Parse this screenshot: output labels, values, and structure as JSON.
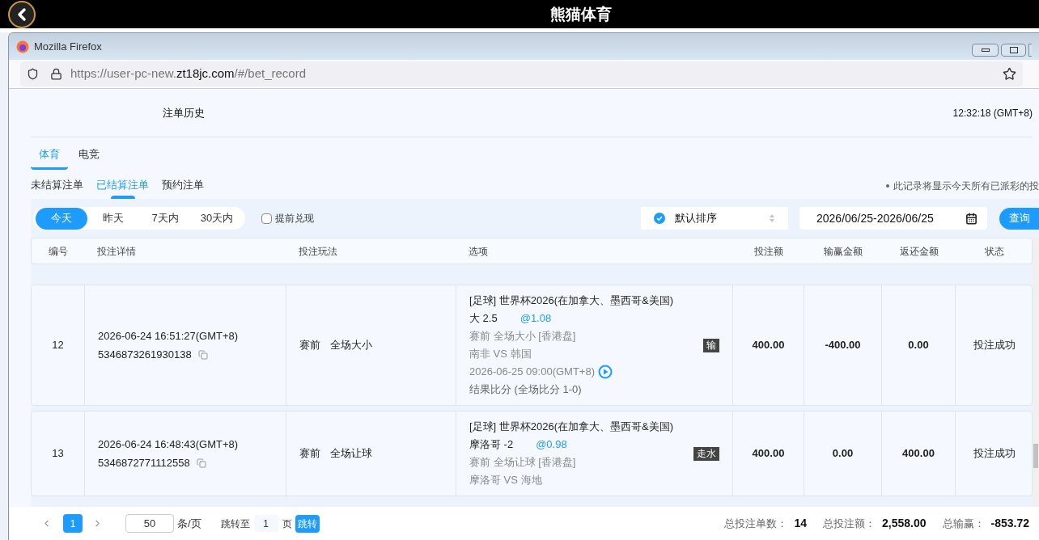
{
  "app_bar": {
    "title": "熊猫体育"
  },
  "browser": {
    "title": "Mozilla Firefox",
    "url": {
      "prefix": "https://user-pc-new.",
      "domain": "zt18jc.com",
      "path": "/#/bet_record"
    }
  },
  "page": {
    "title": "注单历史",
    "time": "12:32:18 (GMT+8)",
    "sport_tabs": [
      {
        "label": "体育",
        "selected": true
      },
      {
        "label": "电竞",
        "selected": false
      }
    ],
    "bet_tabs": [
      {
        "label": "未结算注单",
        "selected": false
      },
      {
        "label": "已结算注单",
        "selected": true
      },
      {
        "label": "预约注单",
        "selected": false
      }
    ],
    "notice": "此记录将显示今天所有已派彩的投",
    "date_filters": [
      {
        "label": "今天",
        "selected": true
      },
      {
        "label": "昨天",
        "selected": false
      },
      {
        "label": "7天内",
        "selected": false
      },
      {
        "label": "30天内",
        "selected": false
      }
    ],
    "early_cashout": {
      "label": "提前兑现",
      "checked": false
    },
    "sort": {
      "label": "默认排序"
    },
    "date_range": "2026/06/25-2026/06/25",
    "query_button": "查询"
  },
  "table": {
    "columns": [
      "编号",
      "投注详情",
      "投注玩法",
      "选项",
      "投注额",
      "输赢金额",
      "返还金额",
      "状态"
    ],
    "rows": [
      {
        "no": "12",
        "time": "2026-06-24 16:51:27(GMT+8)",
        "order_id": "5346873261930138",
        "stage": "赛前",
        "market": "全场大小",
        "league": "[足球] 世界杯2026(在加拿大、墨西哥&美国)",
        "pick": "大 2.5",
        "odds": "@1.08",
        "market_line": "赛前 全场大小 [香港盘]",
        "teams": "南非 VS 韩国",
        "kickoff": "2026-06-25 09:00(GMT+8)",
        "result": "结果比分 (全场比分 1-0)",
        "tag": "输",
        "stake": "400.00",
        "win_loss": "-400.00",
        "returned": "0.00",
        "status": "投注成功"
      },
      {
        "no": "13",
        "time": "2026-06-24 16:48:43(GMT+8)",
        "order_id": "5346872771112558",
        "stage": "赛前",
        "market": "全场让球",
        "league": "[足球] 世界杯2026(在加拿大、墨西哥&美国)",
        "pick": "摩洛哥 -2",
        "odds": "@0.98",
        "market_line": "赛前 全场让球 [香港盘]",
        "teams": "摩洛哥 VS 海地",
        "tag": "走水",
        "stake": "400.00",
        "win_loss": "0.00",
        "returned": "400.00",
        "status": "投注成功"
      }
    ]
  },
  "footer": {
    "pages": [
      {
        "label": "1",
        "selected": true
      }
    ],
    "page_size": "50",
    "page_size_unit": "条/页",
    "goto_label": "跳转至",
    "goto_value": "1",
    "goto_unit": "页",
    "goto_button": "跳转",
    "summaries": [
      {
        "label": "总投注单数：",
        "value": "14"
      },
      {
        "label": "总投注额：",
        "value": "2,558.00"
      },
      {
        "label": "总输赢：",
        "value": "-853.72"
      }
    ]
  }
}
